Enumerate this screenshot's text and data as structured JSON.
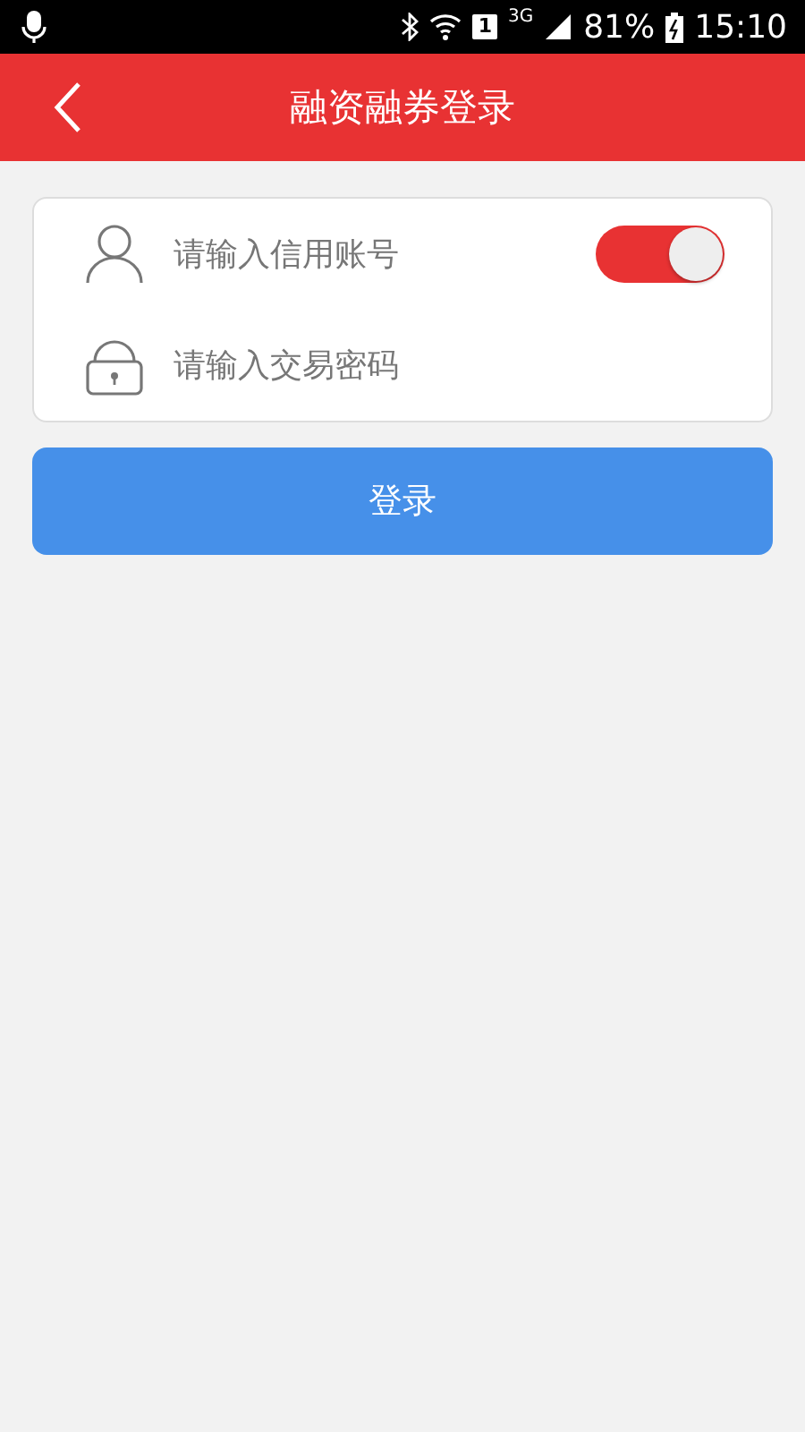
{
  "status_bar": {
    "sim": "1",
    "network": "3G",
    "battery": "81%",
    "time": "15:10"
  },
  "header": {
    "title": "融资融券登录"
  },
  "form": {
    "account": {
      "placeholder": "请输入信用账号"
    },
    "remember": {
      "on": true
    },
    "password": {
      "placeholder": "请输入交易密码"
    }
  },
  "login_button": "登录"
}
